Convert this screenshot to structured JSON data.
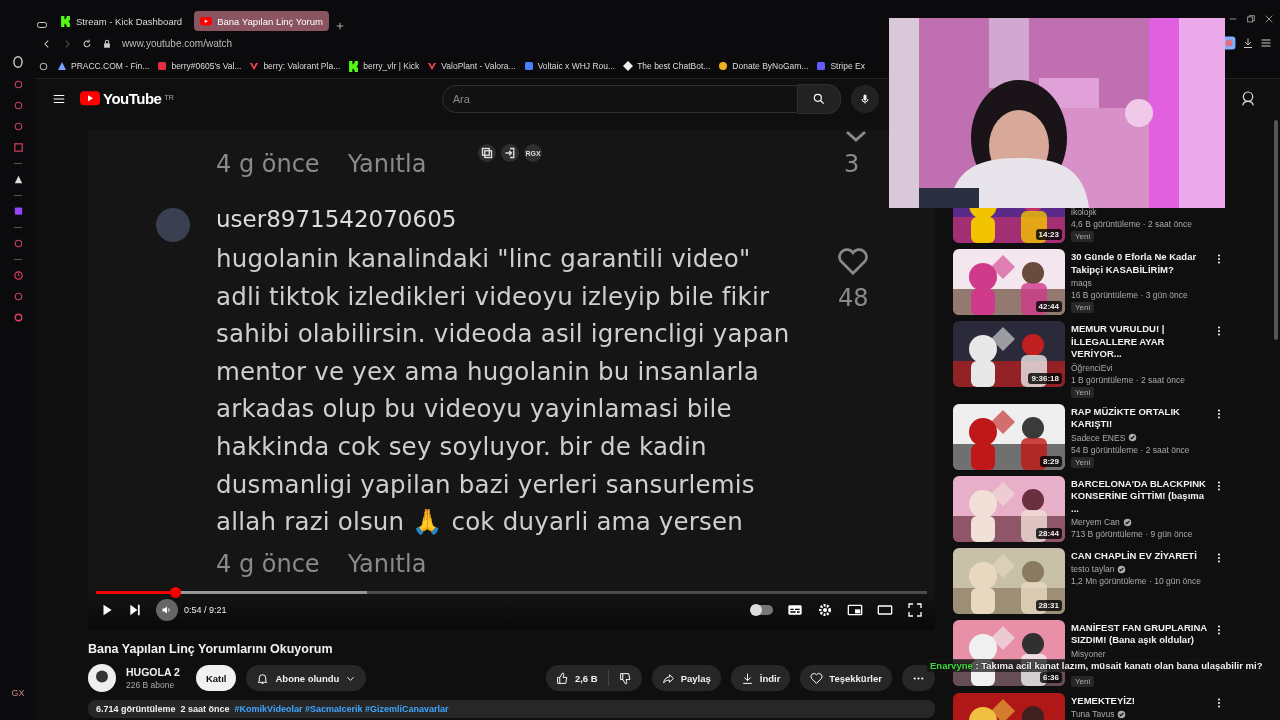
{
  "browser": {
    "tabs": [
      {
        "kind": "kick",
        "title": "Stream - Kick Dashboard",
        "selected": false
      },
      {
        "kind": "youtube",
        "title": "Bana Yapılan Linç Yorum",
        "selected": true
      }
    ],
    "address": "www.youtube.com/watch",
    "bookmarks": [
      {
        "kind": "pracc",
        "label": "PRACC.COM - Fin..."
      },
      {
        "kind": "tracker",
        "label": "berry#0605's Val..."
      },
      {
        "kind": "valorant",
        "label": "berry: Valorant Pla..."
      },
      {
        "kind": "kick",
        "label": "berry_vlr | Kick"
      },
      {
        "kind": "valorant",
        "label": "ValoPlant - Valora..."
      },
      {
        "kind": "doc",
        "label": "Voltaic x WHJ Rou..."
      },
      {
        "kind": "chatbot",
        "label": "The best ChatBot..."
      },
      {
        "kind": "donate",
        "label": "Donate ByNoGam..."
      },
      {
        "kind": "stripe",
        "label": "Stripe Ex"
      }
    ],
    "sidebar_footer": "GX"
  },
  "youtube": {
    "logo": "YouTube",
    "region": "TR",
    "search": {
      "placeholder": "Ara"
    }
  },
  "video": {
    "overlay_label": "RGX",
    "comment": {
      "top_time": "4 g önce",
      "top_reply": "Yanıtla",
      "top_count": "3",
      "user": "user8971542070605",
      "lines": [
        "hugolanin kanalindaki \"linc garantili video\"",
        "adli tiktok izledikleri videoyu izleyip bile fikir",
        "sahibi olabilirsin. videoda asil igrencligi yapan",
        "mentor ve yex ama hugolanin bu insanlarla",
        "arkadas olup bu videoyu yayinlamasi bile",
        "hakkinda cok sey soyluyor. bir de kadin",
        "dusmanligi yapilan bazi yerleri sansurlemis",
        "allah razi olsun 🙏 cok duyarli ama yersen"
      ],
      "likes": "48",
      "time": "4 g önce",
      "reply": "Yanıtla"
    },
    "player": {
      "played": {
        "level": 0.095
      },
      "buffered": {
        "level": 0.326
      },
      "time": "0:54 / 9:21",
      "autoplay": false
    }
  },
  "title": "Bana Yapılan Linç Yorumlarını Okuyorum",
  "channel": {
    "name": "HUGOLA 2",
    "subscribers": "226 B abone"
  },
  "actions": {
    "join": "Katıl",
    "subscribe": "Abone olundu",
    "likes": "2,6 B",
    "share": "Paylaş",
    "download": "İndir",
    "thanks": "Teşekkürler"
  },
  "description": {
    "views": "6.714 görüntüleme",
    "date": "2 saat önce",
    "tags": "#KomikVideolar #SacmaIcerik #GizemliCanavarlar"
  },
  "recommendations": [
    {
      "channel": "ikolojik",
      "verified": false,
      "views": "4,6 B görüntüleme · 2 saat önce",
      "duration": "14:23",
      "badge": "Yeni"
    },
    {
      "title": "30 Günde 0 Eforla Ne Kadar Takipçi KASABİLİRİM?",
      "channel": "maqs",
      "verified": false,
      "views": "16 B görüntüleme · 3 gün önce",
      "duration": "42:44",
      "badge": "Yeni"
    },
    {
      "title": "MEMUR VURULDU! | İLLEGALLERE AYAR VERİYOR...",
      "channel": "ÖğrenciEvi",
      "verified": false,
      "views": "1 B görüntüleme · 2 saat önce",
      "duration": "9:36:18",
      "badge": "Yeni"
    },
    {
      "title": "RAP MÜZİKTE ORTALIK KARIŞTI!",
      "channel": "Sadece ENES",
      "verified": true,
      "views": "54 B görüntüleme · 2 saat önce",
      "duration": "8:29",
      "badge": "Yeni"
    },
    {
      "title": "BARCELONA'DA BLACKPINK KONSERİNE GİTTİM! (başıma ...",
      "channel": "Meryem Can",
      "verified": true,
      "views": "713 B görüntüleme · 9 gün önce",
      "duration": "28:44"
    },
    {
      "title": "CAN CHAPLİN EV ZİYARETİ",
      "channel": "testo taylan",
      "verified": true,
      "views": "1,2 Mn görüntüleme · 10 gün önce",
      "duration": "28:31"
    },
    {
      "title": "MANİFEST FAN GRUPLARINA SIZDIM! (Bana aşık oldular)",
      "channel": "Misyoner",
      "verified": false,
      "duration": "6:36",
      "badge": "Yeni"
    },
    {
      "title": "YEMEKTEYİZ!",
      "channel": "Tuna Tavus",
      "verified": true
    }
  ],
  "chat_overlay": {
    "user": "Enarvyne",
    "color": "#3ddc3d",
    "message": ": Takıma acil kanat lazım, müsait kanatı olan bana ulaşabilir mi?"
  }
}
